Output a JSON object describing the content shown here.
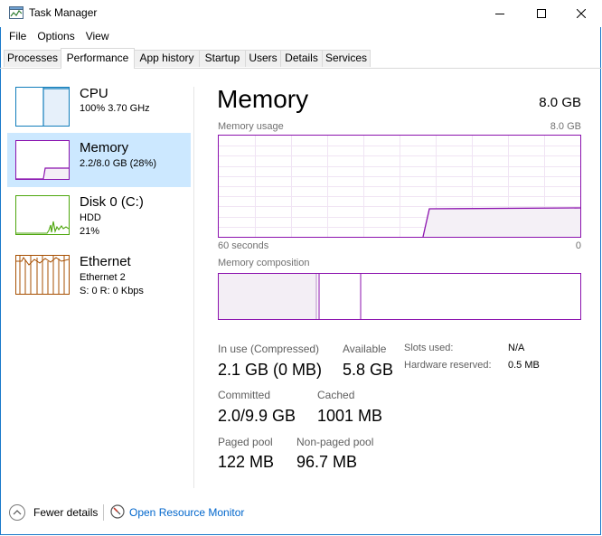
{
  "window": {
    "title": "Task Manager",
    "controls": {
      "minimize": "minimize-icon",
      "maximize": "maximize-icon",
      "close": "close-icon"
    }
  },
  "menu": [
    "File",
    "Options",
    "View"
  ],
  "tabs": [
    {
      "label": "Processes",
      "active": false
    },
    {
      "label": "Performance",
      "active": true
    },
    {
      "label": "App history",
      "active": false
    },
    {
      "label": "Startup",
      "active": false
    },
    {
      "label": "Users",
      "active": false
    },
    {
      "label": "Details",
      "active": false
    },
    {
      "label": "Services",
      "active": false
    }
  ],
  "sidebar": {
    "items": [
      {
        "title": "CPU",
        "lines": [
          "100%  3.70 GHz"
        ],
        "color": "#117dbb",
        "selected": false
      },
      {
        "title": "Memory",
        "lines": [
          "2.2/8.0 GB (28%)"
        ],
        "color": "#8b12ae",
        "selected": true
      },
      {
        "title": "Disk 0 (C:)",
        "lines": [
          "HDD",
          "21%"
        ],
        "color": "#4da60c",
        "selected": false
      },
      {
        "title": "Ethernet",
        "lines": [
          "Ethernet 2",
          "S: 0  R: 0 Kbps"
        ],
        "color": "#a74f01",
        "selected": false
      }
    ]
  },
  "memory": {
    "title": "Memory",
    "total": "8.0 GB",
    "usage_label": "Memory usage",
    "usage_max": "8.0 GB",
    "time_left": "60 seconds",
    "time_right": "0",
    "composition_label": "Memory composition",
    "usage_fraction": 0.28,
    "stats": {
      "in_use_label": "In use (Compressed)",
      "in_use_value": "2.1 GB (0 MB)",
      "available_label": "Available",
      "available_value": "5.8 GB",
      "committed_label": "Committed",
      "committed_value": "2.0/9.9 GB",
      "cached_label": "Cached",
      "cached_value": "1001 MB",
      "paged_label": "Paged pool",
      "paged_value": "122 MB",
      "nonpaged_label": "Non-paged pool",
      "nonpaged_value": "96.7 MB",
      "slots_label": "Slots used:",
      "slots_value": "N/A",
      "hw_reserved_label": "Hardware reserved:",
      "hw_reserved_value": "0.5 MB"
    }
  },
  "footer": {
    "fewer_details": "Fewer details",
    "open_resource_monitor": "Open Resource Monitor"
  }
}
